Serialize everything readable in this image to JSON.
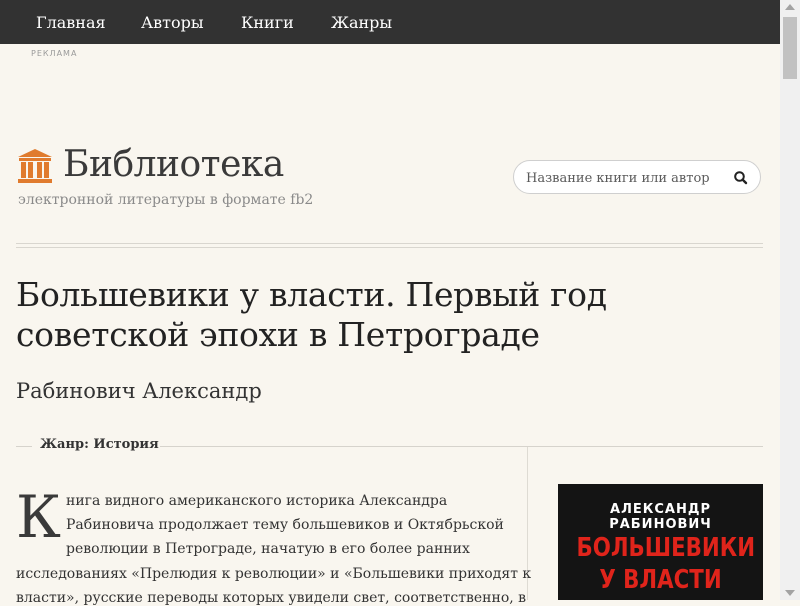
{
  "nav": {
    "items": [
      "Главная",
      "Авторы",
      "Книги",
      "Жанры"
    ]
  },
  "ad_label": "РЕКЛАМА",
  "logo": {
    "title": "Библиотека",
    "subtitle": "электронной литературы в формате fb2",
    "icon": "library-building-icon",
    "icon_color": "#e07b2e"
  },
  "search": {
    "placeholder": "Название книги или автор",
    "value": "",
    "icon": "search-icon"
  },
  "book": {
    "title": "Большевики у власти. Первый год советской эпохи в Петрограде",
    "author": "Рабинович Александр",
    "genre_label": "Жанр:",
    "genre_value": "История",
    "dropcap": "К",
    "description_lines": [
      "нига видного американского историка Александра",
      "Рабиновича продолжает тему большевиков и Октябрьской",
      "революции в Петрограде, начатую в его более ранних",
      "исследованиях «Прелюдия к революции» и «Большевики приходят к",
      "власти», русские переводы которых увидели свет, соответственно, в"
    ],
    "cover": {
      "author": "АЛЕКСАНДР РАБИНОВИЧ",
      "title_lines": [
        "БОЛЬШЕВИКИ",
        "У ВЛАСТИ"
      ],
      "title_color": "#e0241b",
      "bg_color": "#141414"
    }
  },
  "colors": {
    "navbar_bg": "#323232",
    "page_bg": "#f9f6ef",
    "accent": "#e07b2e"
  }
}
